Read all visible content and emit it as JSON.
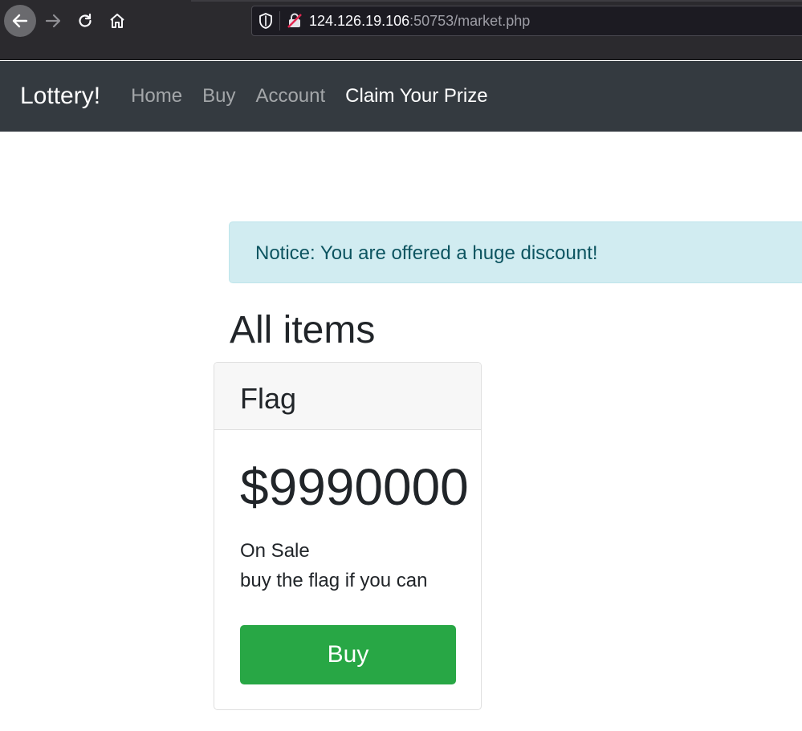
{
  "browser": {
    "url_host": "124.126.19.106",
    "url_rest": ":50753/market.php"
  },
  "navbar": {
    "brand": "Lottery!",
    "links": [
      {
        "label": "Home"
      },
      {
        "label": "Buy"
      },
      {
        "label": "Account"
      },
      {
        "label": "Claim Your Prize"
      }
    ]
  },
  "notice": {
    "text": "Notice: You are offered a huge discount!"
  },
  "main": {
    "title": "All items",
    "items": [
      {
        "name": "Flag",
        "price": "$9990000",
        "status": "On Sale",
        "description": "buy the flag if you can",
        "button_label": "Buy"
      }
    ]
  },
  "colors": {
    "navbar_bg": "#343a40",
    "alert_bg": "#d1ecf1",
    "alert_text": "#0c5460",
    "buy_button": "#28a745"
  }
}
